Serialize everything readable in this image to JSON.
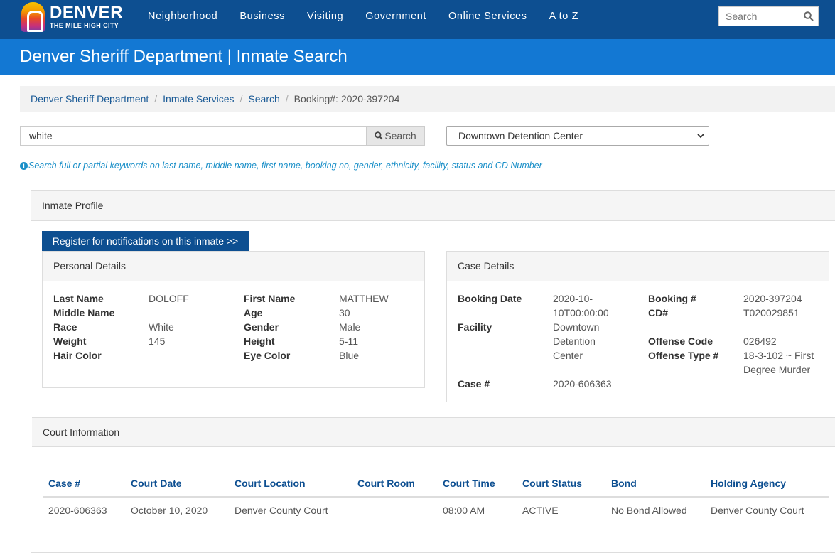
{
  "header": {
    "logo_title": "DENVER",
    "logo_subtitle": "THE MILE HIGH CITY",
    "nav": [
      "Neighborhood",
      "Business",
      "Visiting",
      "Government",
      "Online Services",
      "A to Z"
    ],
    "search_placeholder": "Search",
    "brand_color": "#0d4f91"
  },
  "page_title": "Denver Sheriff Department | Inmate Search",
  "breadcrumb": {
    "items": [
      "Denver Sheriff Department",
      "Inmate Services",
      "Search"
    ],
    "current": "Booking#: 2020-397204"
  },
  "search": {
    "query": "white",
    "button_label": "Search",
    "facility": "Downtown Detention Center",
    "hint": "Search full or partial keywords on last name, middle name, first name, booking no, gender, ethnicity, facility, status and CD Number"
  },
  "profile": {
    "panel_title": "Inmate Profile",
    "notify_button": "Register for notifications on this inmate >>",
    "personal": {
      "title": "Personal Details",
      "last_name_label": "Last Name",
      "last_name": "DOLOFF",
      "first_name_label": "First Name",
      "first_name": "MATTHEW",
      "middle_name_label": "Middle Name",
      "middle_name": "",
      "age_label": "Age",
      "age": "30",
      "race_label": "Race",
      "race": "White",
      "gender_label": "Gender",
      "gender": "Male",
      "weight_label": "Weight",
      "weight": "145",
      "height_label": "Height",
      "height": "5-11",
      "hair_label": "Hair Color",
      "hair": "",
      "eye_label": "Eye Color",
      "eye": "Blue"
    },
    "case": {
      "title": "Case Details",
      "booking_date_label": "Booking Date",
      "booking_date_line1": "2020-10-",
      "booking_date_line2": "10T00:00:00",
      "booking_no_label": "Booking #",
      "booking_no": "2020-397204",
      "cd_label": "CD#",
      "cd": "T020029851",
      "facility_label": "Facility",
      "facility_line1": "Downtown",
      "facility_line2": "Detention",
      "facility_line3": "Center",
      "offense_code_label": "Offense Code",
      "offense_code": "026492",
      "offense_type_label": "Offense Type #",
      "offense_type_line1": "18-3-102 ~ First",
      "offense_type_line2": "Degree Murder",
      "case_no_label": "Case #",
      "case_no": "2020-606363"
    }
  },
  "court": {
    "panel_title": "Court Information",
    "columns": [
      "Case #",
      "Court Date",
      "Court Location",
      "Court Room",
      "Court Time",
      "Court Status",
      "Bond",
      "Holding Agency"
    ],
    "rows": [
      [
        "2020-606363",
        "October 10, 2020",
        "Denver County Court",
        "",
        "08:00 AM",
        "ACTIVE",
        "No Bond Allowed",
        "Denver County Court"
      ]
    ]
  }
}
